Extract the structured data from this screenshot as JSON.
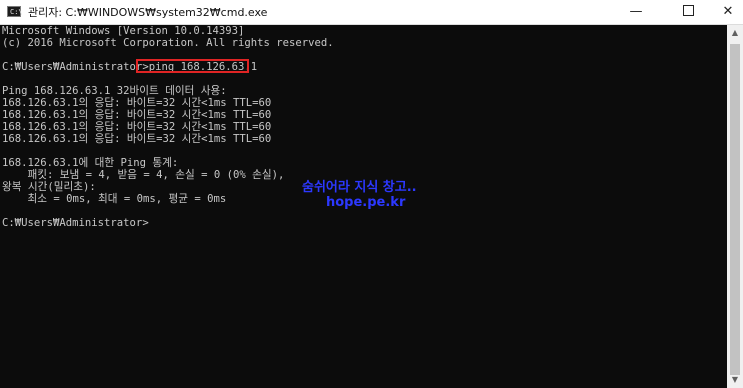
{
  "window": {
    "icon_label": "C:\\",
    "title": "관리자: C:₩WINDOWS₩system32₩cmd.exe",
    "minimize": "—",
    "close": "✕"
  },
  "console": {
    "lines": [
      "Microsoft Windows [Version 10.0.14393]",
      "(c) 2016 Microsoft Corporation. All rights reserved.",
      "",
      "C:₩Users₩Administrator>ping 168.126.63.1",
      "",
      "Ping 168.126.63.1 32바이트 데이터 사용:",
      "168.126.63.1의 응답: 바이트=32 시간<1ms TTL=60",
      "168.126.63.1의 응답: 바이트=32 시간<1ms TTL=60",
      "168.126.63.1의 응답: 바이트=32 시간<1ms TTL=60",
      "168.126.63.1의 응답: 바이트=32 시간<1ms TTL=60",
      "",
      "168.126.63.1에 대한 Ping 통계:",
      "    패킷: 보냄 = 4, 받음 = 4, 손실 = 0 (0% 손실),",
      "왕복 시간(밀리초):",
      "    최소 = 0ms, 최대 = 0ms, 평균 = 0ms",
      "",
      "C:₩Users₩Administrator>"
    ]
  },
  "watermark": {
    "line1": "숨쉬어라 지식 창고..",
    "line2": "hope.pe.kr"
  },
  "scrollbar": {
    "up_arrow": "▲",
    "down_arrow": "▼"
  }
}
